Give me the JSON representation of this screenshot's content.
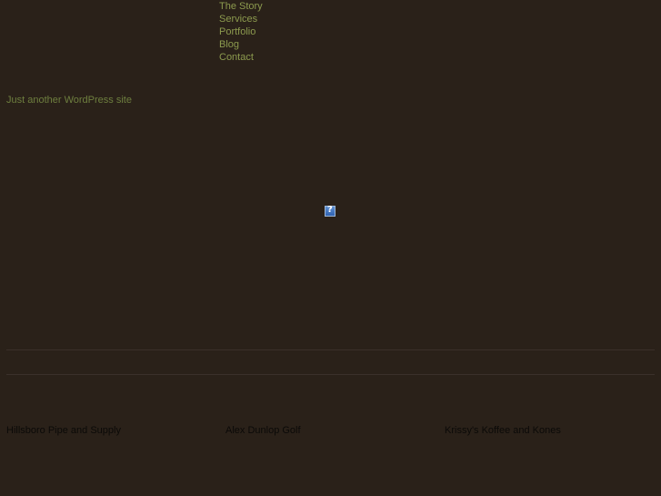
{
  "nav": {
    "items": [
      {
        "label": "The Story"
      },
      {
        "label": "Services"
      },
      {
        "label": "Portfolio"
      },
      {
        "label": "Blog"
      },
      {
        "label": "Contact"
      }
    ]
  },
  "site": {
    "tagline": "Just another WordPress site"
  },
  "clients": [
    {
      "label": "Hillsboro Pipe and Supply"
    },
    {
      "label": "Alex Dunlop Golf"
    },
    {
      "label": "Krissy's Koffee and Kones"
    }
  ],
  "colors": {
    "background": "#2a2119",
    "nav_link": "#8c9a4e",
    "tagline": "#6e7f3f",
    "client_link": "#0b0a08"
  },
  "icons": {
    "placeholder": "broken-image-icon"
  }
}
